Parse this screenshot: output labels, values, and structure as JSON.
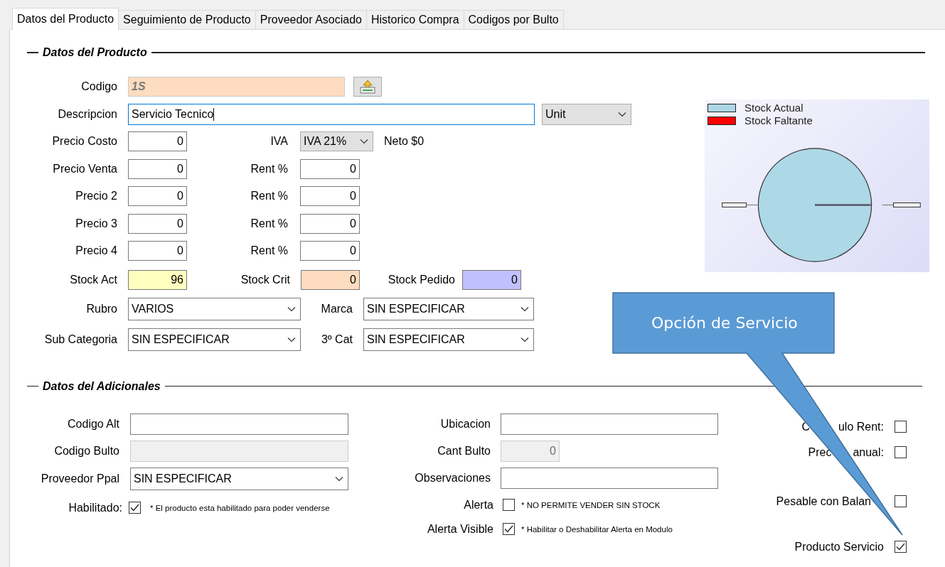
{
  "tabs": [
    {
      "label": "Datos del Producto",
      "selected": true
    },
    {
      "label": "Seguimiento de Producto",
      "selected": false
    },
    {
      "label": "Proveedor Asociado",
      "selected": false
    },
    {
      "label": "Historico Compra",
      "selected": false
    },
    {
      "label": "Codigos por Bulto",
      "selected": false
    }
  ],
  "product_section": {
    "title": "Datos del Producto",
    "codigo": {
      "label": "Codigo",
      "value": "1S"
    },
    "descripcion": {
      "label": "Descripcion",
      "value": "Servicio Tecnico",
      "focused": true
    },
    "unit": {
      "value": "Unit"
    },
    "price_rows": [
      {
        "label": "Precio Costo",
        "value": "0",
        "kind": "iva",
        "side_label": "IVA",
        "side_value": "IVA 21%",
        "note": "Neto $0"
      },
      {
        "label": "Precio Venta",
        "value": "0",
        "kind": "rent",
        "side_label": "Rent %",
        "side_value": "0"
      },
      {
        "label": "Precio 2",
        "value": "0",
        "kind": "rent",
        "side_label": "Rent %",
        "side_value": "0"
      },
      {
        "label": "Precio 3",
        "value": "0",
        "kind": "rent",
        "side_label": "Rent %",
        "side_value": "0"
      },
      {
        "label": "Precio 4",
        "value": "0",
        "kind": "rent",
        "side_label": "Rent %",
        "side_value": "0"
      }
    ],
    "stock": [
      {
        "label": "Stock Act",
        "value": "96",
        "color": "#ffffc0"
      },
      {
        "label": "Stock Crit",
        "value": "0",
        "color": "#fddcbf"
      },
      {
        "label": "Stock Pedido",
        "value": "0",
        "color": "#c0c0ff"
      }
    ],
    "category_rows": [
      {
        "left": {
          "label": "Rubro",
          "value": "VARIOS"
        },
        "right": {
          "label": "Marca",
          "value": "SIN ESPECIFICAR"
        }
      },
      {
        "left": {
          "label": "Sub Categoria",
          "value": "SIN ESPECIFICAR"
        },
        "right": {
          "label": "3º Cat",
          "value": "SIN ESPECIFICAR"
        }
      }
    ],
    "chart": {
      "legend": [
        {
          "label": "Stock Actual",
          "color": "#add8e6"
        },
        {
          "label": "Stock Faltante",
          "color": "#ff0000"
        }
      ]
    }
  },
  "additional_section": {
    "title": "Datos del Adicionales",
    "left_fields": [
      {
        "label": "Codigo Alt",
        "kind": "text"
      },
      {
        "label": "Codigo Bulto",
        "kind": "disabled"
      },
      {
        "label": "Proveedor Ppal",
        "kind": "select",
        "value": "SIN ESPECIFICAR"
      }
    ],
    "habilitado": {
      "label": "Habilitado:",
      "checked": true,
      "note": "* El producto esta habilitado para poder venderse"
    },
    "middle_fields": [
      {
        "label": "Ubicacion",
        "kind": "text"
      },
      {
        "label": "Cant Bulto",
        "kind": "disabled_short",
        "value": "0"
      },
      {
        "label": "Observaciones",
        "kind": "text"
      }
    ],
    "alerts": [
      {
        "label": "Alerta",
        "checked": false,
        "note": "* NO PERMITE VENDER SIN STOCK"
      },
      {
        "label": "Alerta Visible",
        "checked": true,
        "note": "* Habilitar o Deshabilitar Alerta en Modulo"
      }
    ],
    "options": [
      {
        "label_parts": [
          "C",
          "ulo Rent:"
        ],
        "checked": false
      },
      {
        "label_parts": [
          "Prec",
          "anual:"
        ],
        "checked": false
      },
      {
        "label_parts": [
          "Pesable con Balan"
        ],
        "checked": false
      },
      {
        "label_parts": [
          "Producto Servicio"
        ],
        "checked": true
      }
    ]
  },
  "callout": {
    "text": "Opción de Servicio"
  }
}
